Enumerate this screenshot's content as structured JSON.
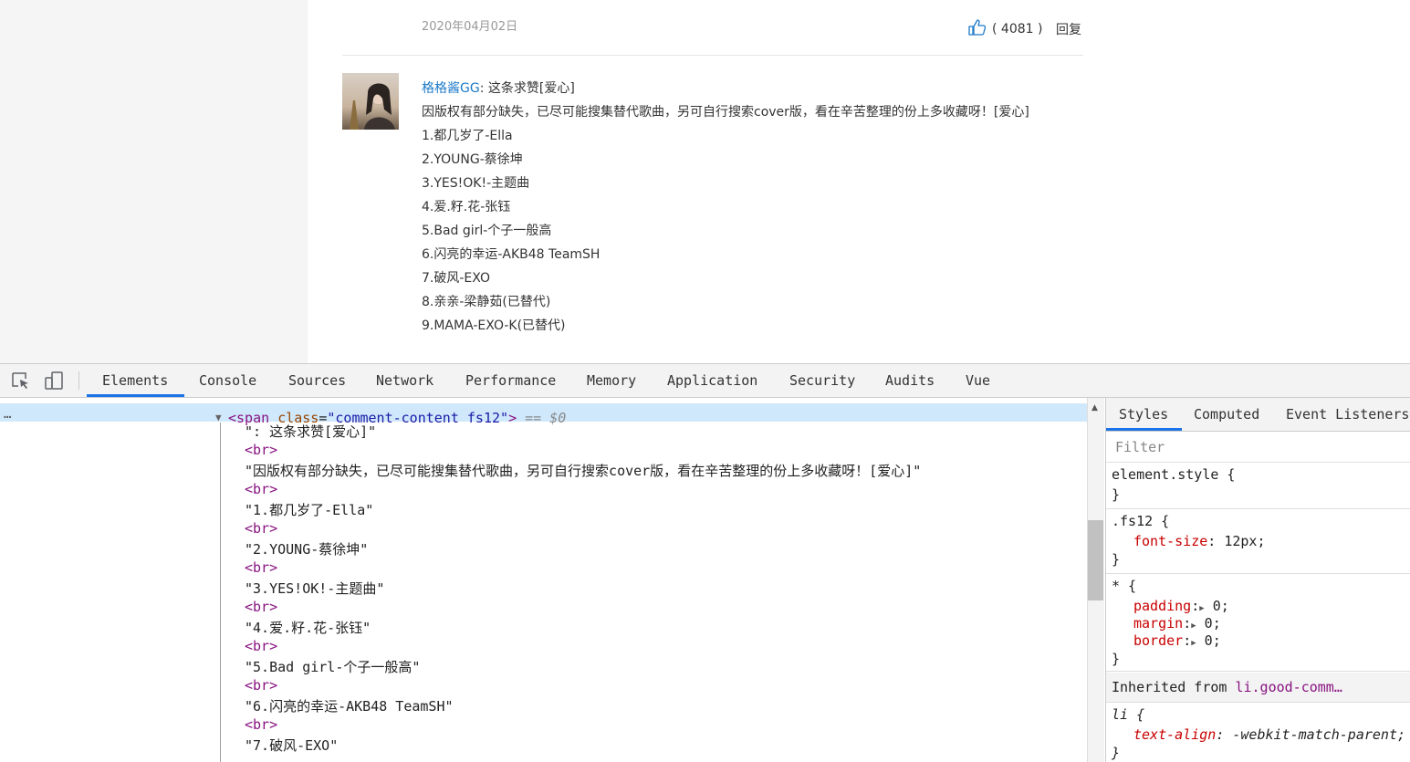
{
  "page": {
    "date": "2020年04月02日",
    "like_count": "( 4081 )",
    "reply_label": "回复",
    "comment": {
      "username": "格格酱GG",
      "text": ": 这条求赞[爱心]",
      "lines": [
        "因版权有部分缺失，已尽可能搜集替代歌曲，另可自行搜索cover版，看在辛苦整理的份上多收藏呀！[爱心]",
        "1.都几岁了-Ella",
        "2.YOUNG-蔡徐坤",
        "3.YES!OK!-主题曲",
        "4.爱.籽.花-张钰",
        "5.Bad girl-个子一般高",
        "6.闪亮的幸运-AKB48 TeamSH",
        "7.破风-EXO",
        "8.亲亲-梁静茹(已替代)",
        "9.MAMA-EXO-K(已替代)"
      ]
    }
  },
  "devtools": {
    "tabs": [
      "Elements",
      "Console",
      "Sources",
      "Network",
      "Performance",
      "Memory",
      "Application",
      "Security",
      "Audits",
      "Vue"
    ],
    "active_tab": "Elements",
    "elements": {
      "dots": "…",
      "selected": {
        "tag_open": "<span",
        "attr_name": "class",
        "attr_value": "\"comment-content fs12\"",
        "tag_close": ">",
        "dollar": "== $0"
      },
      "br": "<br>",
      "nodes": [
        "\": 这条求赞[爱心]\"",
        "\"因版权有部分缺失，已尽可能搜集替代歌曲，另可自行搜索cover版，看在辛苦整理的份上多收藏呀！[爱心]\"",
        "\"1.都几岁了-Ella\"",
        "\"2.YOUNG-蔡徐坤\"",
        "\"3.YES!OK!-主题曲\"",
        "\"4.爱.籽.花-张钰\"",
        "\"5.Bad girl-个子一般高\"",
        "\"6.闪亮的幸运-AKB48 TeamSH\"",
        "\"7.破风-EXO\""
      ]
    },
    "styles": {
      "tabs": [
        "Styles",
        "Computed",
        "Event Listeners"
      ],
      "filter_placeholder": "Filter",
      "element_style": "element.style {",
      "brace_close": "}",
      "fs12_selector": ".fs12 {",
      "fs12_prop": "font-size",
      "fs12_value": " 12px;",
      "star_selector": "* {",
      "padding_prop": "padding",
      "margin_prop": "margin",
      "border_prop": "border",
      "zero_value": " 0;",
      "inherited_label": "Inherited from ",
      "inherited_source": "li.good-comm…",
      "li_selector": "li {",
      "li_prop": "text-align",
      "li_value": " -webkit-match-parent;"
    }
  }
}
